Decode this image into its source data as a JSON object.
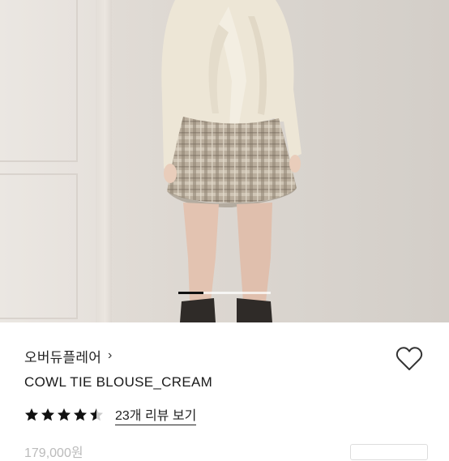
{
  "product_image": {
    "alt_subject": "model-photo",
    "carousel_progress": 0.27
  },
  "brand": {
    "name": "오버듀플레어",
    "chevron": "›"
  },
  "product": {
    "title": "COWL TIE BLOUSE_CREAM",
    "price": "179,000원"
  },
  "rating": {
    "stars": 4.5,
    "review_link": "23개 리뷰 보기"
  },
  "icons": {
    "wishlist": "heart-outline-icon",
    "star": "star-icon"
  },
  "colors": {
    "text": "#222222",
    "muted_price": "#bbbbbb",
    "progress_fill": "#111111"
  }
}
